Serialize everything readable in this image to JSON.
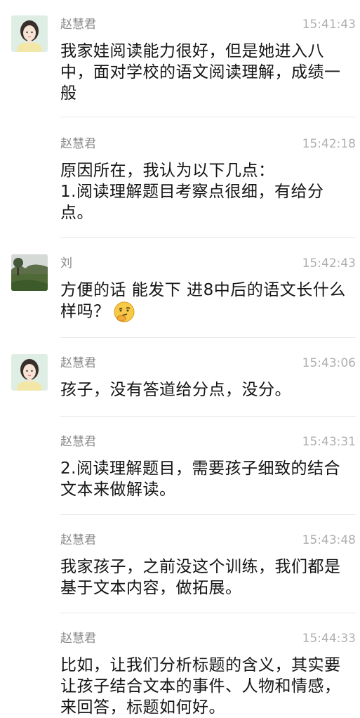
{
  "messages": [
    {
      "sender": "赵慧君",
      "time": "15:41:43",
      "text": "我家娃阅读能力很好，但是她进入八中，面对学校的语文阅读理解，成绩一般",
      "avatar": "woman-avatar"
    },
    {
      "sender": "赵慧君",
      "time": "15:42:18",
      "text": "原因所在，我认为以下几点：\n1.阅读理解题目考察点很细，有给分点。",
      "avatar": ""
    },
    {
      "sender": "刘",
      "time": "15:42:43",
      "text": "方便的话 能发下 进8中后的语文长什么样吗？",
      "emoji": "thinking-emoji",
      "avatar": "landscape-avatar"
    },
    {
      "sender": "赵慧君",
      "time": "15:43:06",
      "text": "孩子，没有答道给分点，没分。",
      "avatar": "woman-avatar"
    },
    {
      "sender": "赵慧君",
      "time": "15:43:31",
      "text": "2.阅读理解题目，需要孩子细致的结合文本来做解读。",
      "avatar": ""
    },
    {
      "sender": "赵慧君",
      "time": "15:43:48",
      "text": "我家孩子，之前没这个训练，我们都是基于文本内容，做拓展。",
      "avatar": ""
    },
    {
      "sender": "赵慧君",
      "time": "15:44:33",
      "text": "比如，让我们分析标题的含义，其实要让孩子结合文本的事件、人物和情感，来回答，标题如何好。",
      "avatar": ""
    }
  ]
}
